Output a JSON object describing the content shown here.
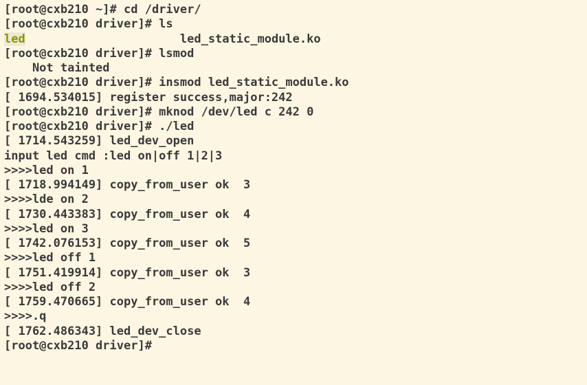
{
  "lines": [
    {
      "prompt": "[root@cxb210 ~]# ",
      "command": "cd /driver/"
    },
    {
      "prompt": "[root@cxb210 driver]# ",
      "command": "ls"
    },
    {
      "ls_highlight": "led",
      "ls_rest": "                      led_static_module.ko"
    },
    {
      "prompt": "[root@cxb210 driver]# ",
      "command": "lsmod"
    },
    {
      "output": "    Not tainted"
    },
    {
      "prompt": "[root@cxb210 driver]# ",
      "command": "insmod led_static_module.ko"
    },
    {
      "output": "[ 1694.534015] register success,major:242"
    },
    {
      "prompt": "[root@cxb210 driver]# ",
      "command": "mknod /dev/led c 242 0"
    },
    {
      "prompt": "[root@cxb210 driver]# ",
      "command": "./led"
    },
    {
      "output": "[ 1714.543259] led_dev_open"
    },
    {
      "output": "input led cmd :led on|off 1|2|3"
    },
    {
      "output": ">>>>led on 1"
    },
    {
      "output": "[ 1718.994149] copy_from_user ok  3"
    },
    {
      "output": ">>>>lde on 2"
    },
    {
      "output": "[ 1730.443383] copy_from_user ok  4"
    },
    {
      "output": ">>>>led on 3"
    },
    {
      "output": "[ 1742.076153] copy_from_user ok  5"
    },
    {
      "output": ">>>>led off 1"
    },
    {
      "output": "[ 1751.419914] copy_from_user ok  3"
    },
    {
      "output": ">>>>led off 2"
    },
    {
      "output": "[ 1759.470665] copy_from_user ok  4"
    },
    {
      "output": ">>>>.q"
    },
    {
      "output": "[ 1762.486343] led_dev_close"
    },
    {
      "prompt": "[root@cxb210 driver]# ",
      "command": ""
    }
  ]
}
